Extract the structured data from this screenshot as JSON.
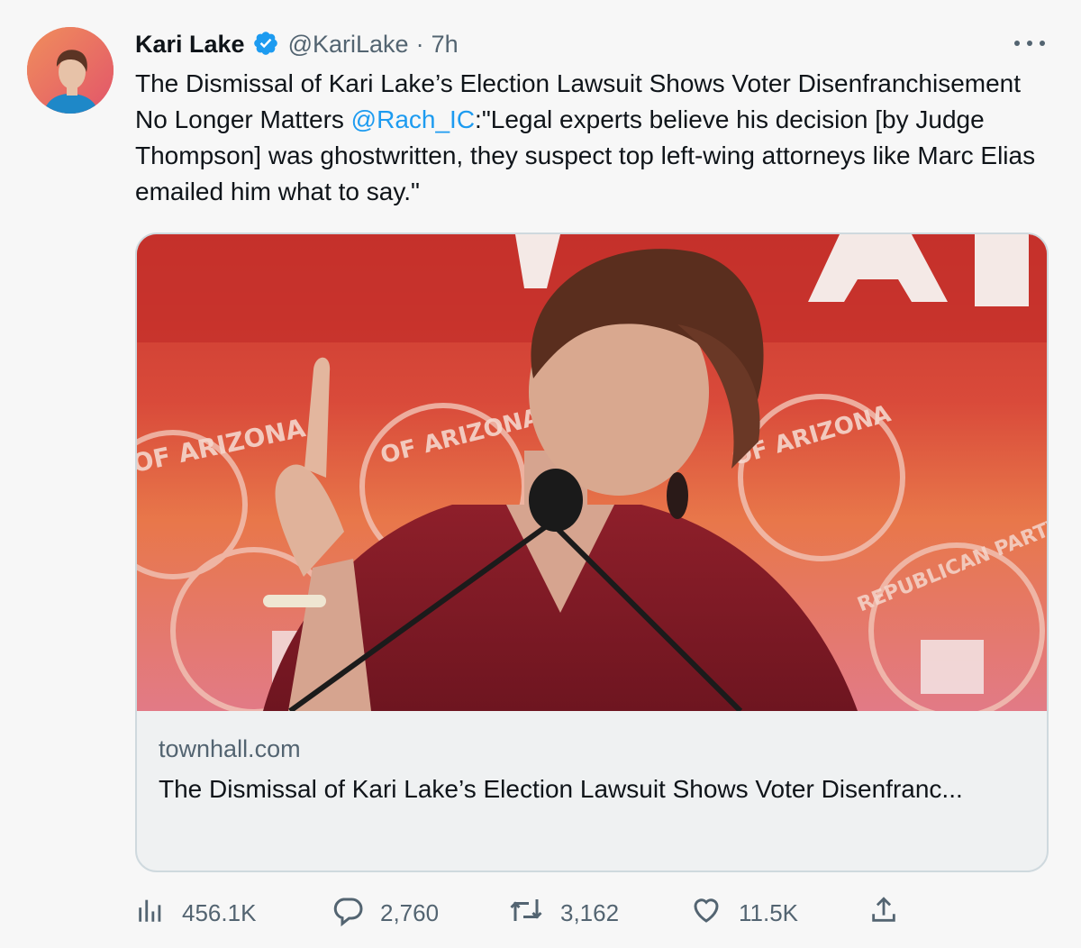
{
  "author": {
    "name": "Kari Lake",
    "handle": "@KariLake",
    "separator": "·",
    "time": "7h"
  },
  "tweet": {
    "text_part1": "The Dismissal of Kari Lake’s Election Lawsuit Shows Voter Disenfranchisement No Longer Matters ",
    "mention": "@Rach_IC",
    "text_part2": ":\"Legal experts believe his decision [by Judge Thompson] was ghostwritten, they suspect top left-wing attorneys like Marc Elias emailed him what to say.\""
  },
  "card": {
    "domain": "townhall.com",
    "title": "The Dismissal of Kari Lake’s Election Lawsuit Shows Voter Disenfranc...",
    "image_backdrop_text": "OF ARIZONA",
    "image_seal_text": "REPUBLICAN PARTY"
  },
  "metrics": {
    "views": "456.1K",
    "replies": "2,760",
    "retweets": "3,162",
    "likes": "11.5K"
  },
  "icons": {
    "verified": "verified-badge-icon",
    "more": "more-icon",
    "views": "views-icon",
    "reply": "reply-icon",
    "retweet": "retweet-icon",
    "like": "heart-icon",
    "share": "share-icon"
  },
  "colors": {
    "accent": "#1d9bf0",
    "text": "#0f1419",
    "secondary": "#536471",
    "border": "#cfd9de"
  }
}
